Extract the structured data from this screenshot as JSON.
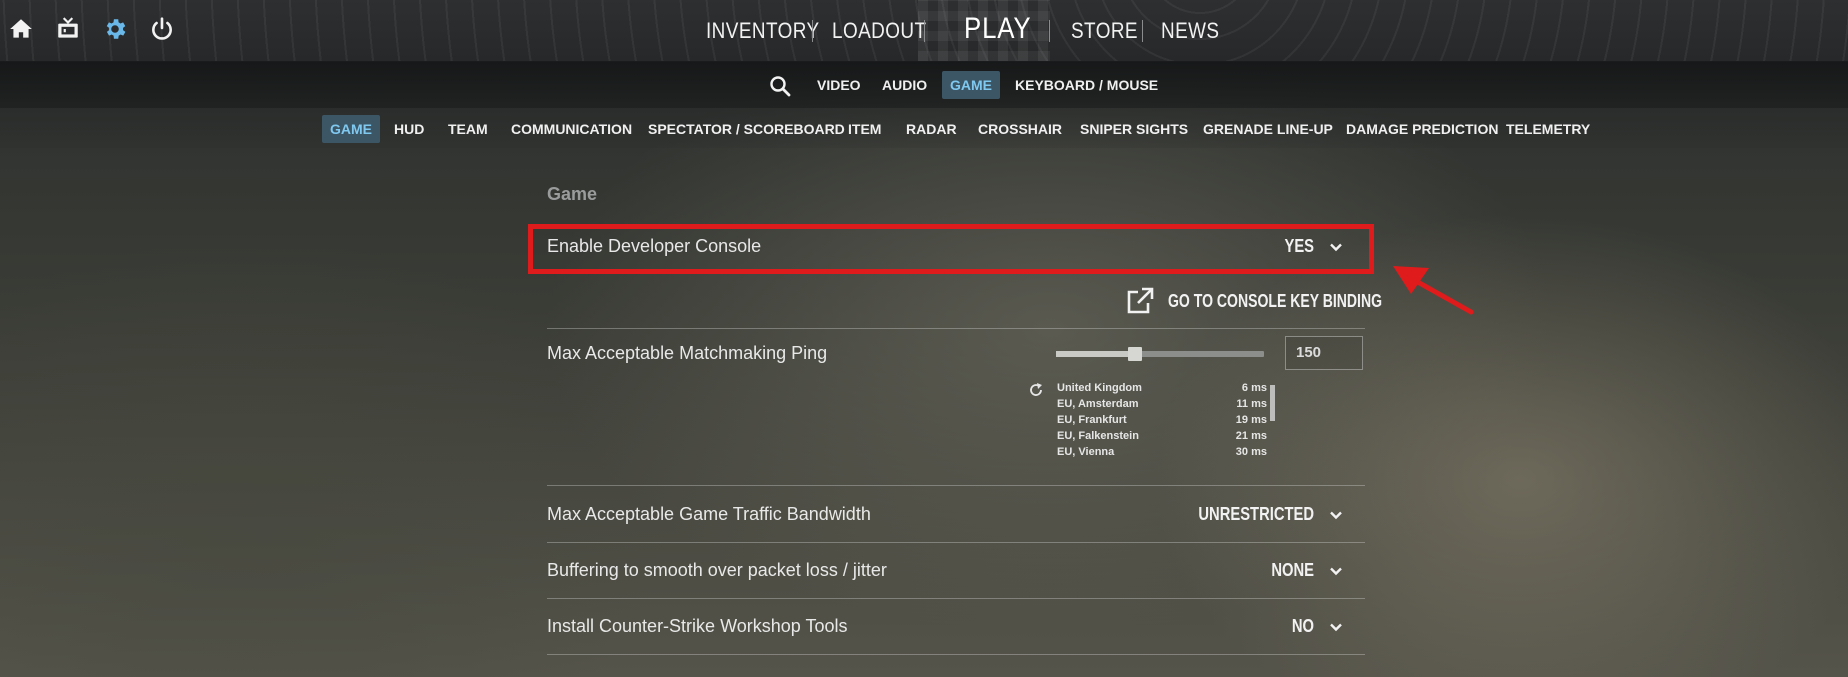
{
  "top_icons": [
    "home-icon",
    "tv-icon",
    "settings-gear-icon",
    "power-icon"
  ],
  "main_nav": {
    "inventory": "INVENTORY",
    "loadout": "LOADOUT",
    "play": "PLAY",
    "store": "STORE",
    "news": "NEWS"
  },
  "settings_tabs": [
    "VIDEO",
    "AUDIO",
    "GAME",
    "KEYBOARD / MOUSE"
  ],
  "settings_tab_active": "GAME",
  "game_subtabs": [
    "GAME",
    "HUD",
    "TEAM",
    "COMMUNICATION",
    "SPECTATOR / SCOREBOARD",
    "ITEM",
    "RADAR",
    "CROSSHAIR",
    "SNIPER SIGHTS",
    "GRENADE LINE-UP",
    "DAMAGE PREDICTION",
    "TELEMETRY"
  ],
  "game_subtab_active": "GAME",
  "section_title": "Game",
  "settings": {
    "dev_console": {
      "label": "Enable Developer Console",
      "value": "YES"
    },
    "console_link": "GO TO CONSOLE KEY BINDING",
    "ping": {
      "label": "Max Acceptable Matchmaking Ping",
      "value": "150",
      "slider_fraction": 0.38
    },
    "bandwidth": {
      "label": "Max Acceptable Game Traffic Bandwidth",
      "value": "UNRESTRICTED"
    },
    "buffering": {
      "label": "Buffering to smooth over packet loss / jitter",
      "value": "NONE"
    },
    "workshop": {
      "label": "Install Counter-Strike Workshop Tools",
      "value": "NO"
    }
  },
  "servers": [
    {
      "name": "United Kingdom",
      "ping": "6 ms"
    },
    {
      "name": "EU, Amsterdam",
      "ping": "11 ms"
    },
    {
      "name": "EU, Frankfurt",
      "ping": "19 ms"
    },
    {
      "name": "EU, Falkenstein",
      "ping": "21 ms"
    },
    {
      "name": "EU, Vienna",
      "ping": "30 ms"
    }
  ],
  "colors": {
    "accent": "#7fc8f0",
    "active_tab_bg": "#3c5666",
    "highlight": "#e01b1b"
  }
}
